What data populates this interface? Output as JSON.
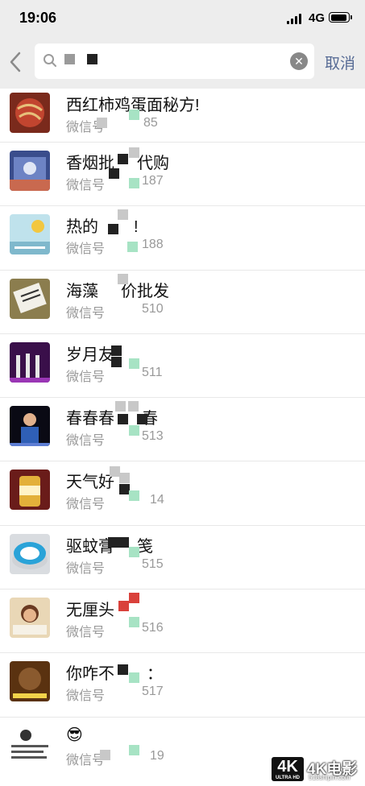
{
  "status_bar": {
    "time": "19:06",
    "network": "4G"
  },
  "search": {
    "query_visible": "",
    "cancel_label": "取消"
  },
  "results": [
    {
      "title": "西红柿鸡蛋面秘方!",
      "sub_prefix": "微信号",
      "sub_suffix": "85"
    },
    {
      "title": "香烟批",
      "title_tail": "代购",
      "sub_prefix": "微信号",
      "sub_suffix": "187"
    },
    {
      "title": "热的",
      "title_tail": "!",
      "sub_prefix": "微信号",
      "sub_suffix": "188"
    },
    {
      "title": "海藻",
      "title_tail": "价批发",
      "sub_prefix": "微信号",
      "sub_suffix": "510"
    },
    {
      "title": "岁月友",
      "sub_prefix": "微信号",
      "sub_suffix": "511"
    },
    {
      "title": "春春春",
      "title_tail": "春",
      "sub_prefix": "微信号",
      "sub_suffix": "513"
    },
    {
      "title": "天气好",
      "sub_prefix": "微信号",
      "sub_suffix": "14"
    },
    {
      "title": "驱蚊膏",
      "sub_prefix": "微信号",
      "sub_suffix": "515"
    },
    {
      "title": "无厘头",
      "sub_prefix": "微信号",
      "sub_suffix": "516"
    },
    {
      "title": "你咋不",
      "sub_prefix": "微信号",
      "sub_suffix": "517"
    },
    {
      "title": "😎",
      "sub_prefix": "微信号",
      "sub_suffix": "19"
    }
  ],
  "watermark": {
    "badge": "4K",
    "badge_sub": "ULTRA HD",
    "text": "4K电影",
    "url": "518shipin.com"
  },
  "colors": {
    "header_bg": "#ededed",
    "link": "#576b95",
    "secondary_text": "#999999"
  }
}
